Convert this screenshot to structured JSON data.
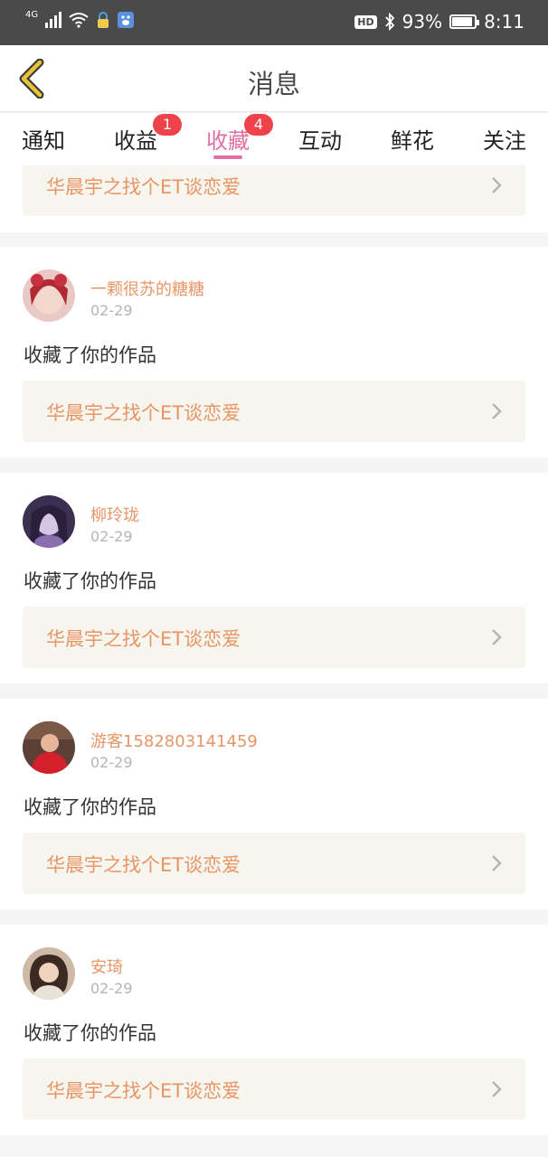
{
  "status_bar": {
    "network": "4G",
    "hd": "HD",
    "battery": "93%",
    "battery_level": 0.93,
    "time": "8:11",
    "icons": [
      "signal-icon",
      "wifi-icon",
      "lock-icon",
      "baidu-icon",
      "bluetooth-icon",
      "battery-icon"
    ]
  },
  "header": {
    "title": "消息",
    "back_icon": "chevron-left-icon"
  },
  "tabs": [
    {
      "label": "通知",
      "badge": ""
    },
    {
      "label": "收益",
      "badge": "1"
    },
    {
      "label": "收藏",
      "badge": "4",
      "active": true
    },
    {
      "label": "互动",
      "badge": ""
    },
    {
      "label": "鲜花",
      "badge": ""
    },
    {
      "label": "关注",
      "badge": ""
    }
  ],
  "colors": {
    "accent": "#e06fa3",
    "badge": "#f0424a",
    "username": "#e89566",
    "link_bg": "#f6f5ee"
  },
  "partial_work_title": "华晨宇之找个ET谈恋爱",
  "items": [
    {
      "user": "一颗很苏的糖糖",
      "date": "02-29",
      "action": "收藏了你的作品",
      "work": "华晨宇之找个ET谈恋爱"
    },
    {
      "user": "柳玲珑",
      "date": "02-29",
      "action": "收藏了你的作品",
      "work": "华晨宇之找个ET谈恋爱"
    },
    {
      "user": "游客1582803141459",
      "date": "02-29",
      "action": "收藏了你的作品",
      "work": "华晨宇之找个ET谈恋爱"
    },
    {
      "user": "安琦",
      "date": "02-29",
      "action": "收藏了你的作品",
      "work": "华晨宇之找个ET谈恋爱"
    }
  ]
}
